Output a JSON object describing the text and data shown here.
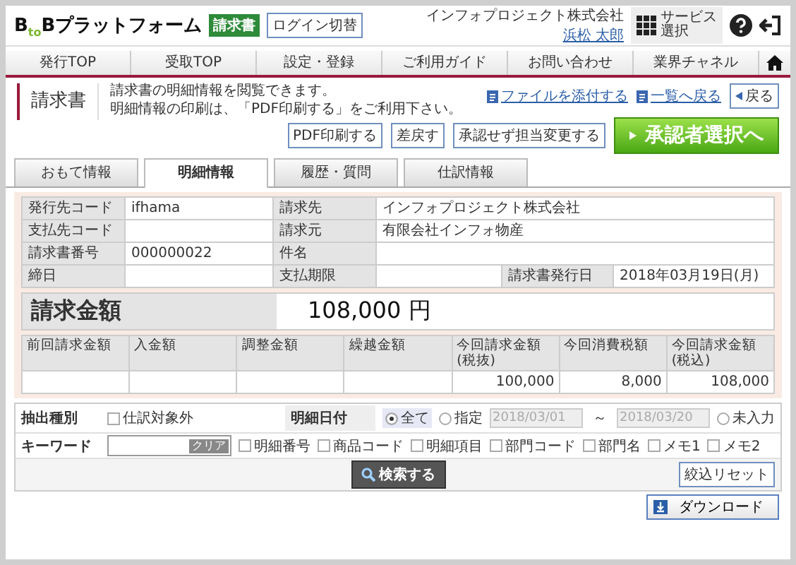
{
  "header": {
    "logo": "B$_{to}$Bプラットフォーム",
    "badge": "請求書",
    "switch_button": "ログイン切替",
    "company": "インフォプロジェクト株式会社",
    "user": "浜松 太郎",
    "service_button": "サービス選択"
  },
  "nav": [
    "発行TOP",
    "受取TOP",
    "設定・登録",
    "ご利用ガイド",
    "お問い合わせ",
    "業界チャネル"
  ],
  "page": {
    "title": "請求書",
    "description": [
      "請求書の明細情報を閲覧できます。",
      "明細情報の印刷は、「PDF印刷する」をご利用下さい。"
    ],
    "links": [
      "ファイルを添付する",
      "一覧へ戻る"
    ],
    "back_button": "戻る",
    "actions": [
      "PDF印刷する",
      "差戻す",
      "承認せず担当変更する"
    ],
    "primary_button": "承認者選択へ"
  },
  "tabs": [
    {
      "label": "おもて情報",
      "selected": false
    },
    {
      "label": "明細情報",
      "selected": true
    },
    {
      "label": "履歴・質問",
      "selected": false
    },
    {
      "label": "仕訳情報",
      "selected": false
    }
  ],
  "details": [
    [
      {
        "kind": "label",
        "text": "発行先コード"
      },
      {
        "kind": "value",
        "text": "ifhama"
      },
      {
        "kind": "label",
        "text": "請求先"
      },
      {
        "kind": "wide",
        "text": "インフォプロジェクト株式会社"
      }
    ],
    [
      {
        "kind": "label",
        "text": "支払先コード"
      },
      {
        "kind": "value"
      },
      {
        "kind": "label",
        "text": "請求元"
      },
      {
        "kind": "wide",
        "text": "有限会社インフォ物産"
      }
    ],
    [
      {
        "kind": "label",
        "text": "請求書番号"
      },
      {
        "kind": "value",
        "text": "000000022"
      },
      {
        "kind": "label",
        "text": "件名"
      },
      {
        "kind": "wide"
      }
    ],
    [
      {
        "kind": "label",
        "text": "締日"
      },
      {
        "kind": "value"
      },
      {
        "kind": "label",
        "text": "支払期限"
      },
      {
        "kind": "value"
      },
      {
        "kind": "label",
        "text": "請求書発行日"
      },
      {
        "kind": "value",
        "text": "2018年03月19日(月)"
      }
    ]
  ],
  "amount": {
    "label": "請求金額",
    "value": "108,000 円"
  },
  "totals": [
    {
      "heading": "前回請求金額"
    },
    {
      "heading": "入金額"
    },
    {
      "heading": "調整金額"
    },
    {
      "heading": "繰越金額"
    },
    {
      "heading": "今回請求金額(税抜)",
      "value": "100,000"
    },
    {
      "heading": "今回消費税額",
      "value": "8,000"
    },
    {
      "heading": "今回請求金額(税込)",
      "value": "108,000"
    }
  ],
  "filter": {
    "extract_label": "抽出種別",
    "exclude": {
      "label": "仕訳対象外",
      "checked": false
    },
    "date_label": "明細日付",
    "radios": [
      {
        "label": "全て",
        "selected": true,
        "kind": "plain"
      },
      {
        "label": "指定",
        "selected": false,
        "kind": "range"
      },
      {
        "label": "未入力",
        "selected": false,
        "kind": "plain"
      }
    ],
    "date_from": "2018/03/01",
    "date_to": "2018/03/20",
    "tilde": "～",
    "dates_disabled": true,
    "keyword_label": "キーワード",
    "clear_button": "クリア",
    "fields": [
      {
        "label": "明細番号",
        "checked": false
      },
      {
        "label": "商品コード",
        "checked": false
      },
      {
        "label": "明細項目",
        "checked": false
      },
      {
        "label": "部門コード",
        "checked": false
      },
      {
        "label": "部門名",
        "checked": false
      },
      {
        "label": "メモ1",
        "checked": false
      },
      {
        "label": "メモ2",
        "checked": false
      }
    ],
    "search_button": "検索する",
    "reset_button": "絞込リセット"
  },
  "download_button": "ダウンロード"
}
